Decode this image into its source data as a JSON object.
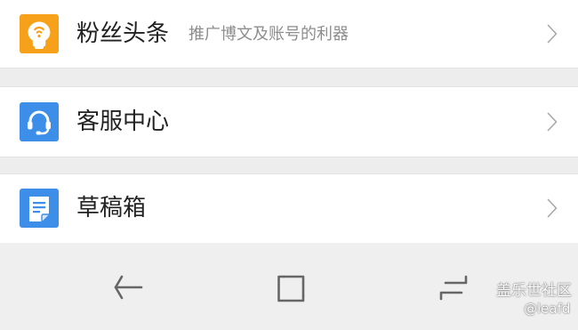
{
  "menu": {
    "items": [
      {
        "label": "粉丝头条",
        "description": "推广博文及账号的利器",
        "icon": "lightbulb-icon",
        "icon_color": "#f7a11a"
      },
      {
        "label": "客服中心",
        "icon": "headset-icon",
        "icon_color": "#3c8ee8"
      },
      {
        "label": "草稿箱",
        "icon": "draft-document-icon",
        "icon_color": "#3c8ee8"
      }
    ]
  },
  "nav_bar": {
    "buttons": [
      "back-icon",
      "home-icon",
      "recent-apps-icon"
    ]
  },
  "watermark": {
    "title": "盖乐世社区",
    "user": "@leafd"
  }
}
